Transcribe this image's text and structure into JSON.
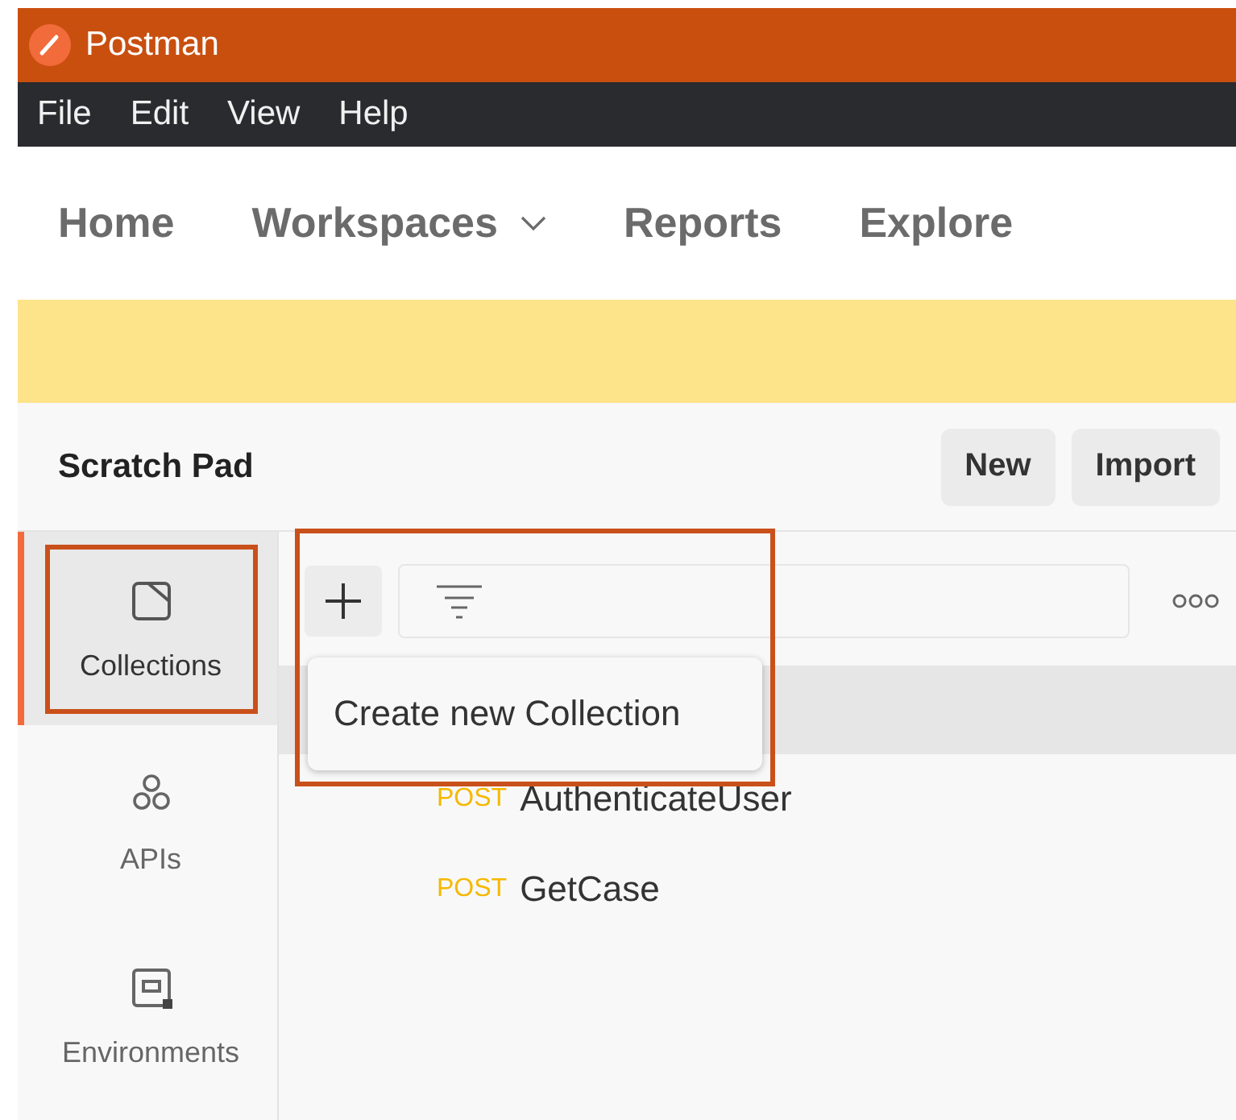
{
  "window": {
    "title": "Postman"
  },
  "menu": [
    "File",
    "Edit",
    "View",
    "Help"
  ],
  "nav": [
    {
      "label": "Home",
      "has_dropdown": false
    },
    {
      "label": "Workspaces",
      "has_dropdown": true
    },
    {
      "label": "Reports",
      "has_dropdown": false
    },
    {
      "label": "Explore",
      "has_dropdown": false
    }
  ],
  "workspace": {
    "title": "Scratch Pad",
    "buttons": [
      "New",
      "Import"
    ]
  },
  "sidebar": {
    "items": [
      {
        "label": "Collections",
        "kind": "collections",
        "selected": true
      },
      {
        "label": "APIs",
        "kind": "apis",
        "selected": false
      },
      {
        "label": "Environments",
        "kind": "environments",
        "selected": false
      }
    ]
  },
  "tooltip": "Create new Collection",
  "requests": [
    {
      "method": "POST",
      "name": "AuthenticateUser"
    },
    {
      "method": "POST",
      "name": "GetCase"
    }
  ]
}
